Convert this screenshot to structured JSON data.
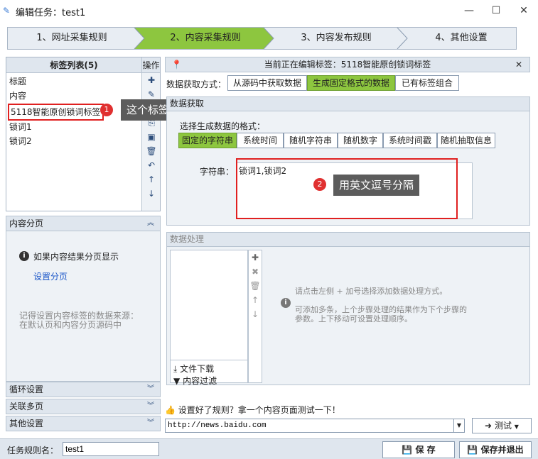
{
  "window": {
    "title": "编辑任务：test1",
    "min": "—",
    "max": "☐",
    "close": "✕"
  },
  "steps": [
    "1、网址采集规则",
    "2、内容采集规则",
    "3、内容发布规则",
    "4、其他设置"
  ],
  "tag_list": {
    "header": "标签列表(5)",
    "ops_header": "操作",
    "items": [
      "标题",
      "内容",
      "5118智能原创锁词标签",
      "锁词1",
      "锁词2"
    ]
  },
  "annotation1": {
    "num": "1",
    "text": "这个标签用来设置多个锁词标签"
  },
  "annotation2": {
    "num": "2",
    "text": "用英文逗号分隔"
  },
  "content_paging": {
    "title": "内容分页",
    "info": "如果内容结果分页显示",
    "link": "设置分页",
    "hint1": "记得设置内容标签的数据来源：",
    "hint2": "在默认页和内容分页源码中"
  },
  "sections": [
    "循环设置",
    "关联多页",
    "其他设置"
  ],
  "editing": {
    "header": "当前正在编辑标签：5118智能原创锁词标签"
  },
  "data_source": {
    "label": "数据获取方式：",
    "options": [
      "从源码中获取数据",
      "生成固定格式的数据",
      "已有标签组合"
    ],
    "selected": 1
  },
  "data_gen": {
    "group_title": "数据获取",
    "format_label": "选择生成数据的格式：",
    "formats": [
      "固定的字符串",
      "系统时间",
      "随机字符串",
      "随机数字",
      "系统时间戳",
      "随机抽取信息"
    ],
    "selected": 0,
    "string_label": "字符串：",
    "string_value": "锁词1,锁词2"
  },
  "data_processing": {
    "title": "数据处理",
    "hint1": "请点击左侧 + 加号选择添加数据处理方式。",
    "hint2": "可添加多条，上个步骤处理的结果作为下个步骤的",
    "hint3": "参数。上下移动可设置处理顺序。",
    "list_items": [
      "文件下载",
      "内容过滤"
    ]
  },
  "test": {
    "prompt": "设置好了规则？拿一个内容页面测试一下！",
    "url": "http://news.baidu.com",
    "button": "测试"
  },
  "footer": {
    "name_label": "任务规则名：",
    "name_value": "test1",
    "save": "保 存",
    "save_exit": "保存并退出"
  }
}
